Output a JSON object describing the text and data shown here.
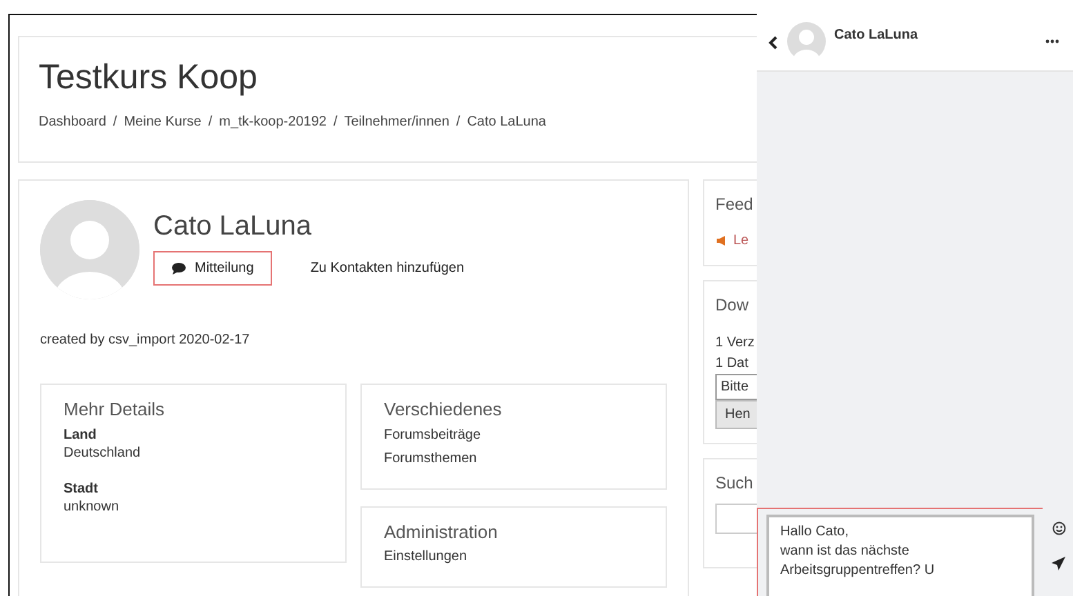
{
  "course_header": {
    "title": "Testkurs Koop",
    "separator": "/",
    "breadcrumb": [
      "Dashboard",
      "Meine Kurse",
      "m_tk-koop-20192",
      "Teilnehmer/innen",
      "Cato LaLuna"
    ]
  },
  "profile": {
    "name": "Cato LaLuna",
    "actions": [
      {
        "kind": "button",
        "label": "Mitteilung",
        "highlighted": true
      },
      {
        "kind": "link",
        "label": "Zu Kontakten hinzufügen",
        "highlighted": false
      }
    ],
    "created": "created by csv_import 2020-02-17"
  },
  "detail_columns": [
    [
      {
        "title": "Mehr Details",
        "items": [
          {
            "kind": "field",
            "label": "Land",
            "value": "Deutschland"
          },
          {
            "kind": "field",
            "label": "Stadt",
            "value": "unknown"
          }
        ]
      }
    ],
    [
      {
        "title": "Verschiedenes",
        "items": [
          {
            "kind": "link",
            "value": "Forumsbeiträge"
          },
          {
            "kind": "link",
            "value": "Forumsthemen"
          }
        ]
      },
      {
        "title": "Administration",
        "items": [
          {
            "kind": "link",
            "value": "Einstellungen"
          }
        ]
      }
    ]
  ],
  "side_blocks": [
    {
      "title": "Feed",
      "lines": [
        {
          "kind": "icon-link",
          "text": "Le"
        }
      ]
    },
    {
      "title": "Dow",
      "lines": [
        {
          "kind": "text",
          "text": "1 Verz"
        },
        {
          "kind": "text",
          "text": "1 Dat"
        },
        {
          "kind": "select",
          "text": "Bitte"
        },
        {
          "kind": "button",
          "text": "Hen"
        }
      ]
    },
    {
      "title": "Such",
      "lines": [
        {
          "kind": "input"
        }
      ]
    }
  ],
  "drawer": {
    "contact": "Cato LaLuna",
    "message_draft": "Hallo Cato,\nwann ist das nächste\nArbeitsgruppentreffen? U",
    "composer_highlighted": true
  }
}
